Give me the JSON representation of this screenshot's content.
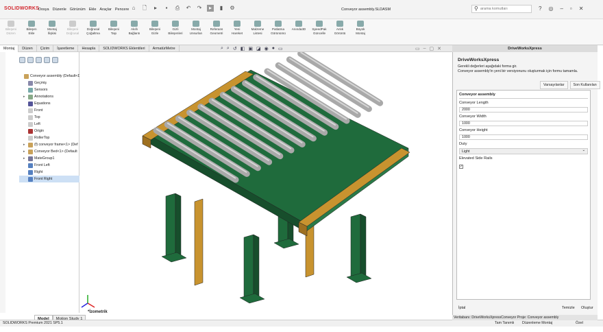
{
  "app": {
    "logo": "SOLIDWORKS",
    "doc_title": "Conveyor assembly.SLDASM",
    "menus": [
      "Dosya",
      "Düzenle",
      "Görünüm",
      "Ekle",
      "Araçlar",
      "Pencere"
    ],
    "search_placeholder": "arama komutları"
  },
  "ribbon": [
    {
      "l1": "Bileşeni",
      "l2": "Düzen",
      "dim": true
    },
    {
      "l1": "Bileşen",
      "l2": "Ekle",
      "dim": false
    },
    {
      "l1": "Montaj",
      "l2": "İlişkisi",
      "dim": false
    },
    {
      "l1": "Bileşeni",
      "l2": "Doğrusal",
      "dim": true
    },
    {
      "l1": "Doğrusal",
      "l2": "Çoğaltma",
      "dim": false
    },
    {
      "l1": "Bileşeni",
      "l2": "Taşı",
      "dim": false
    },
    {
      "l1": "Akıllı",
      "l2": "Bağlantı",
      "dim": false
    },
    {
      "l1": "Bileşeni",
      "l2": "Gizle",
      "dim": false
    },
    {
      "l1": "Gizli",
      "l2": "Bileşenleri",
      "dim": false
    },
    {
      "l1": "Montaj",
      "l2": "Unsurları",
      "dim": false
    },
    {
      "l1": "Referans",
      "l2": "Geometri",
      "dim": false
    },
    {
      "l1": "Yeni",
      "l2": "Hareket",
      "dim": false
    },
    {
      "l1": "Malzeme",
      "l2": "Listesi",
      "dim": false
    },
    {
      "l1": "Patlatma",
      "l2": "Görünümü",
      "dim": false
    },
    {
      "l1": "Anında3D",
      "l2": "",
      "dim": false
    },
    {
      "l1": "SpeedPak",
      "l2": "Güncelle",
      "dim": false
    },
    {
      "l1": "Anlık",
      "l2": "Görüntü",
      "dim": false
    },
    {
      "l1": "Büyük",
      "l2": "Montaj",
      "dim": false
    }
  ],
  "tabs": [
    "Montaj",
    "Düzen",
    "Çizim",
    "İşaretleme",
    "Hesapla",
    "SOLIDWORKS Eklentileri",
    "ArmatürMetre"
  ],
  "tree": [
    {
      "label": "Conveyor assembly  (Default<D",
      "color": "#c9a25a",
      "exp": "",
      "indent": 0,
      "sel": false
    },
    {
      "label": "Geçmiş",
      "color": "#88a",
      "exp": "",
      "indent": 1,
      "sel": false
    },
    {
      "label": "Sensors",
      "color": "#7aa",
      "exp": "",
      "indent": 1,
      "sel": false
    },
    {
      "label": "Annotations",
      "color": "#8a8",
      "exp": "▸",
      "indent": 1,
      "sel": false
    },
    {
      "label": "Equations",
      "color": "#559",
      "exp": "",
      "indent": 1,
      "sel": false
    },
    {
      "label": "Front",
      "color": "#ccc",
      "exp": "",
      "indent": 1,
      "sel": false
    },
    {
      "label": "Top",
      "color": "#ccc",
      "exp": "",
      "indent": 1,
      "sel": false
    },
    {
      "label": "Left",
      "color": "#ccc",
      "exp": "",
      "indent": 1,
      "sel": false
    },
    {
      "label": "Origin",
      "color": "#a33",
      "exp": "",
      "indent": 1,
      "sel": false
    },
    {
      "label": "RollerTop",
      "color": "#ccc",
      "exp": "",
      "indent": 1,
      "sel": false
    },
    {
      "label": "(f) conveyor frame<1> (Def",
      "color": "#c9a25a",
      "exp": "▸",
      "indent": 1,
      "sel": false
    },
    {
      "label": "Conveyor Bed<1> (Default",
      "color": "#c9a25a",
      "exp": "▸",
      "indent": 1,
      "sel": false
    },
    {
      "label": "MateGroup1",
      "color": "#779",
      "exp": "▸",
      "indent": 1,
      "sel": false
    },
    {
      "label": "Front Left",
      "color": "#5580c0",
      "exp": "",
      "indent": 1,
      "sel": false
    },
    {
      "label": "Right",
      "color": "#5580c0",
      "exp": "",
      "indent": 1,
      "sel": false
    },
    {
      "label": "Front Right",
      "color": "#5580c0",
      "exp": "",
      "indent": 1,
      "sel": true
    }
  ],
  "view": {
    "label": "*İzometrik"
  },
  "bottom_tabs": [
    "Model",
    "Motion Study 1"
  ],
  "status": {
    "left": "SOLIDWORKS Premium 2021 SP5.1",
    "mid": "Tam Tanımlı",
    "mode": "Düzenleme Montaj",
    "custom": "Özel"
  },
  "panel": {
    "header": "DriveWorksXpress",
    "title": "DriveWorksXpress",
    "desc1": "Gerekli değerleri aşağıdaki forma gir.",
    "desc2": "Conveyor assembly'in yeni bir versiyonunu oluşturmak için formu tamamla.",
    "btn_defaults": "Varsayılanlar",
    "btn_last": "Son Kullanılan",
    "section": "Conveyor assembly",
    "fields": [
      {
        "label": "Conveyor Length",
        "value": "2000"
      },
      {
        "label": "Conveyor Width",
        "value": "1000"
      },
      {
        "label": "Conveyor Height",
        "value": "1000"
      }
    ],
    "duty_label": "Duty",
    "duty_value": "Light",
    "rails_label": "Elevated Side Rails",
    "rails_checked": "✓",
    "cancel": "İptal",
    "clear": "Temizle",
    "create": "Oluştur",
    "nav": "Veritabanı: DriveWorksXpressConveyor  Proje: Conveyor assembly"
  },
  "colors": {
    "frame": "#1f6b3c",
    "rail": "#c8932f",
    "roller": "#a9a9a9",
    "accent": "#d2232a"
  }
}
